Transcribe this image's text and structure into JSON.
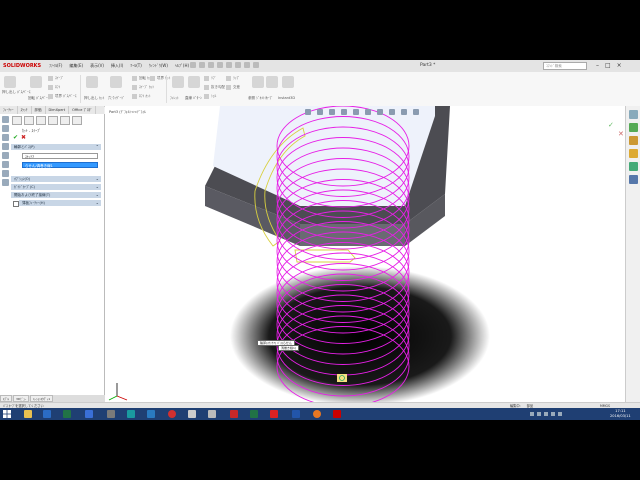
{
  "app": {
    "brand": "SOLIDWORKS",
    "doc_title": "Part3 *",
    "search_placeholder": "ｺﾏﾝﾄﾞ検索",
    "menu": [
      "ﾌｧｲﾙ(F)",
      "編集(E)",
      "表示(V)",
      "挿入(I)",
      "ﾂｰﾙ(T)",
      "ｳｨﾝﾄﾞｳ(W)",
      "ﾍﾙﾌﾟ(H)"
    ]
  },
  "ribbon": {
    "groups": [
      {
        "label": "押し出し ﾎﾞｽ/ﾍﾞｰｽ"
      },
      {
        "label": "回転 ﾎﾞｽ/ﾍﾞｰｽ"
      },
      {
        "label": "ｽｲｰﾌﾟ"
      },
      {
        "label": "ﾛﾌﾄ"
      },
      {
        "label": "境界 ﾎﾞｽ/ﾍﾞｰｽ"
      },
      {
        "label": "押し出し ｶｯﾄ"
      },
      {
        "label": "穴 ｳｨｻﾞｰﾄﾞ"
      },
      {
        "label": "回転 ｶｯﾄ"
      },
      {
        "label": "ｽｲｰﾌﾟ ｶｯﾄ"
      },
      {
        "label": "ﾛﾌﾄ ｶｯﾄ"
      },
      {
        "label": "境界 ｶｯﾄ"
      },
      {
        "label": "ﾌｨﾚｯﾄ"
      },
      {
        "label": "直線 ﾊﾟﾀｰﾝ"
      },
      {
        "label": "ﾘﾌﾞ"
      },
      {
        "label": "抜き勾配"
      },
      {
        "label": "ｼｪﾙ"
      },
      {
        "label": "ﾗｯﾌﾟ"
      },
      {
        "label": "交差"
      },
      {
        "label": "参照 ｼﾞｵﾒﾄﾘ"
      },
      {
        "label": "ｶｰﾌﾞ"
      },
      {
        "label": "Instant3D"
      }
    ]
  },
  "panel": {
    "tabs": [
      "ﾌｨｰﾁｬｰ",
      "ｽｹｯﾁ",
      "評価",
      "DimXpert",
      "Office ﾌﾟﾛﾀﾞ"
    ],
    "feature_title": "ｶｯﾄ - ｽｲｰﾌﾟ",
    "sections": [
      {
        "label": "輪郭とﾊﾟｽ(P)"
      },
      {
        "label": "ｵﾌﾟｼｮﾝ(O)"
      },
      {
        "label": "ｶﾞｲﾄﾞｶｰﾌﾞ(C)"
      },
      {
        "label": "開始および終了接線(T)"
      },
      {
        "label": "薄板ﾌｨｰﾁｬｰ(H)"
      }
    ],
    "profile_field": "ｽｹｯﾁ7",
    "path_field": "らせん/渦巻き線1"
  },
  "viewport": {
    "breadcrumb": "Part3 (ﾃﾞﾌｫﾙﾄ<<ﾃﾞﾌｫﾙ",
    "tooltip1": "輪郭(ｽｹｯﾁ7) ﾊﾟｽ(らせん",
    "tooltip2": "渦巻き線1)"
  },
  "model_tabs": [
    "ﾓﾃﾞﾙ",
    "3Dﾋﾞｭｰ",
    "ﾓｰｼｮﾝｽﾀﾃﾞｨ1"
  ],
  "status": {
    "left": "ﾊﾟｽ ｶｰﾌﾞを選択してください",
    "mid": [
      "編集中:",
      "部品"
    ],
    "right": "MMGS"
  },
  "taskbar": {
    "time": "17:11",
    "date": "2016/03/11"
  },
  "colors": {
    "helix": "#e620e6",
    "profile": "#e0d840",
    "selection_blue": "#3399ff"
  }
}
